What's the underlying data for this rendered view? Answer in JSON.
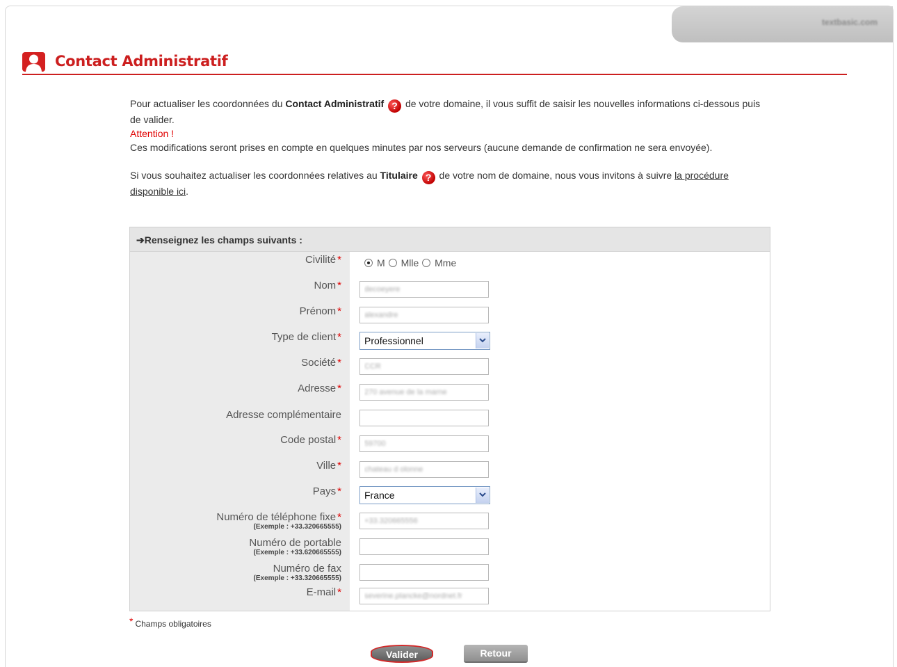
{
  "site": {
    "tab_label": "textbasic.com"
  },
  "header": {
    "title": "Contact Administratif"
  },
  "intro": {
    "p1_a": "Pour actualiser les coordonnées du ",
    "p1_bold": "Contact Administratif",
    "p1_b": " de votre domaine, il vous suffit de saisir les nouvelles informations ci-dessous puis de valider.",
    "attention": "Attention !",
    "p2": "Ces modifications seront prises en compte en quelques minutes par nos serveurs (aucune demande de confirmation ne sera envoyée).",
    "p3_a": "Si vous souhaitez actualiser les coordonnées relatives au ",
    "p3_bold": "Titulaire",
    "p3_b": " de votre nom de domaine, nous vous invitons à suivre ",
    "p3_link": "la procédure disponible ici",
    "p3_end": ".",
    "help_glyph": "?"
  },
  "form": {
    "heading": "➔Renseignez les champs suivants :",
    "required_star": "*",
    "civilite": {
      "label": "Civilité",
      "options": [
        "M",
        "Mlle",
        "Mme"
      ],
      "selected": "M"
    },
    "fields": {
      "nom": {
        "label": "Nom",
        "value": "decoeyere"
      },
      "prenom": {
        "label": "Prénom",
        "value": "alexandre"
      },
      "type_client": {
        "label": "Type de client",
        "value": "Professionnel"
      },
      "societe": {
        "label": "Société",
        "value": "CCR"
      },
      "adresse": {
        "label": "Adresse",
        "value": "270 avenue de la marne"
      },
      "adresse_comp": {
        "label": "Adresse complémentaire",
        "value": ""
      },
      "code_postal": {
        "label": "Code postal",
        "value": "59700"
      },
      "ville": {
        "label": "Ville",
        "value": "chateau d olonne"
      },
      "pays": {
        "label": "Pays",
        "value": "France"
      },
      "tel_fixe": {
        "label": "Numéro de téléphone fixe",
        "hint": "(Exemple : +33.320665555)",
        "value": "+33.320665556"
      },
      "portable": {
        "label": "Numéro de portable",
        "hint": "(Exemple : +33.620665555)",
        "value": ""
      },
      "fax": {
        "label": "Numéro de fax",
        "hint": "(Exemple : +33.320665555)",
        "value": ""
      },
      "email": {
        "label": "E-mail",
        "value": "severine.plancke@nordnet.fr"
      }
    }
  },
  "footer": {
    "required_note": "Champs obligatoires",
    "valider_label": "Valider",
    "retour_label": "Retour"
  },
  "colors": {
    "accent": "#cc1f1f",
    "required": "#e00000"
  }
}
